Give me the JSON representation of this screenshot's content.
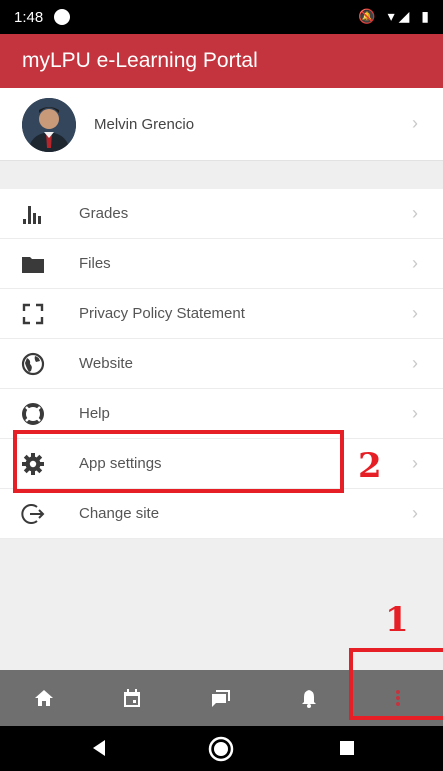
{
  "status_bar": {
    "time": "1:48",
    "icons": "🔕 ▾◢ ▮"
  },
  "app_bar": {
    "title": "myLPU e-Learning Portal"
  },
  "profile": {
    "name": "Melvin Grencio"
  },
  "menu": {
    "items": [
      {
        "label": "Grades",
        "icon": "bar-chart-icon"
      },
      {
        "label": "Files",
        "icon": "folder-icon"
      },
      {
        "label": "Privacy Policy Statement",
        "icon": "frame-corners-icon"
      },
      {
        "label": "Website",
        "icon": "globe-icon"
      },
      {
        "label": "Help",
        "icon": "lifebuoy-icon"
      },
      {
        "label": "App settings",
        "icon": "gear-icon"
      },
      {
        "label": "Change site",
        "icon": "logout-icon"
      }
    ]
  },
  "chevron": "›",
  "bottom_nav": [
    "home-icon",
    "calendar-icon",
    "messages-icon",
    "bell-icon",
    "more-vertical-icon"
  ],
  "annotations": {
    "label_1": "1",
    "label_2": "2"
  },
  "colors": {
    "accent": "#c3343e",
    "annotation": "#e61f26",
    "bottom_nav": "#6f6f6f"
  }
}
